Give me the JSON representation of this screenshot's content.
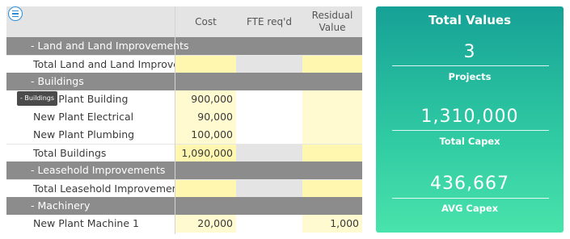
{
  "grid": {
    "columns": {
      "cost": "Cost",
      "fte": "FTE req'd",
      "residual_line1": "Residual",
      "residual_line2": "Value"
    },
    "tooltip": "- Buildings",
    "rows": [
      {
        "type": "group",
        "label": "-  Land and Land Improvements"
      },
      {
        "type": "total",
        "label": "Total Land and Land Improvements",
        "cost": "",
        "fte": "",
        "residual": ""
      },
      {
        "type": "group",
        "label": "-  Buildings"
      },
      {
        "type": "item",
        "label": "New Plant Building",
        "cost": "900,000",
        "fte": "",
        "residual": ""
      },
      {
        "type": "item",
        "label": "New Plant Electrical",
        "cost": "90,000",
        "fte": "",
        "residual": ""
      },
      {
        "type": "item",
        "label": "New Plant Plumbing",
        "cost": "100,000",
        "fte": "",
        "residual": ""
      },
      {
        "type": "total",
        "label": "Total Buildings",
        "cost": "1,090,000",
        "fte": "",
        "residual": ""
      },
      {
        "type": "group",
        "label": "-  Leasehold Improvements"
      },
      {
        "type": "total",
        "label": "Total Leasehold Improvements",
        "cost": "",
        "fte": "",
        "residual": ""
      },
      {
        "type": "group",
        "label": "-  Machinery"
      },
      {
        "type": "item",
        "label": "New Plant Machine 1",
        "cost": "20,000",
        "fte": "",
        "residual": "1,000"
      }
    ]
  },
  "summary": {
    "title": "Total Values",
    "stats": [
      {
        "value": "3",
        "label": "Projects"
      },
      {
        "value": "1,310,000",
        "label": "Total Capex"
      },
      {
        "value": "436,667",
        "label": "AVG Capex"
      }
    ]
  },
  "colors": {
    "panel_top": "#16a196",
    "panel_bottom": "#49e3ac",
    "group_row": "#8c8c8c",
    "editable_cell": "#fffad0"
  }
}
